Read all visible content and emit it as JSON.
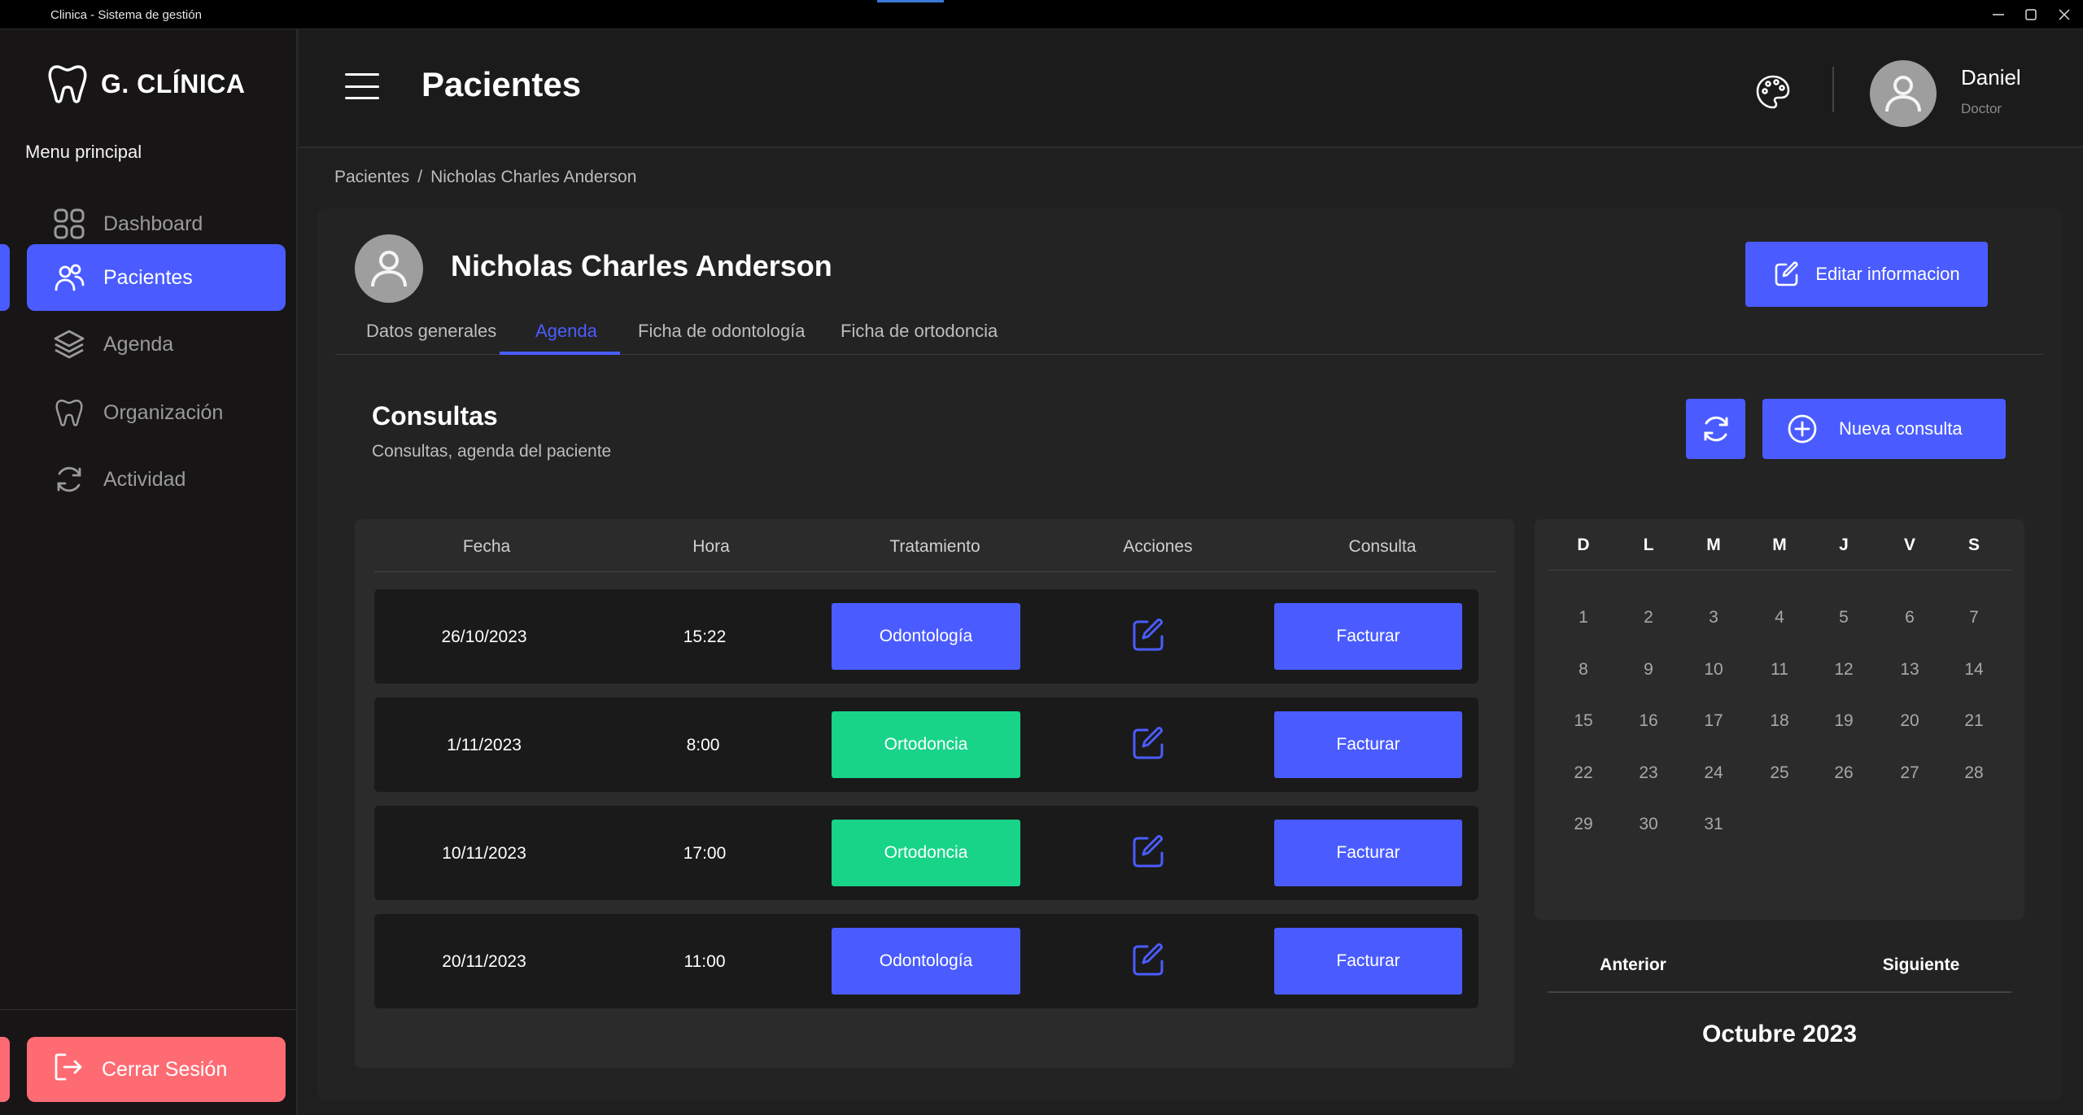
{
  "window": {
    "title": "Clinica - Sistema de gestión"
  },
  "sidebar": {
    "brand": "G. CLÍNICA",
    "menu_title": "Menu principal",
    "items": [
      {
        "label": "Dashboard",
        "icon": "grid-icon",
        "active": false
      },
      {
        "label": "Pacientes",
        "icon": "users-icon",
        "active": true
      },
      {
        "label": "Agenda",
        "icon": "layers-icon",
        "active": false
      },
      {
        "label": "Organización",
        "icon": "tooth-icon",
        "active": false
      },
      {
        "label": "Actividad",
        "icon": "refresh-icon",
        "active": false
      }
    ],
    "logout": "Cerrar Sesión"
  },
  "header": {
    "title": "Pacientes",
    "user": {
      "name": "Daniel",
      "role": "Doctor"
    }
  },
  "breadcrumb": {
    "root": "Pacientes",
    "separator": "/",
    "current": "Nicholas Charles Anderson"
  },
  "patient": {
    "name": "Nicholas Charles Anderson",
    "edit_label": "Editar informacion"
  },
  "tabs": [
    {
      "label": "Datos generales",
      "active": false
    },
    {
      "label": "Agenda",
      "active": true
    },
    {
      "label": "Ficha de odontología",
      "active": false
    },
    {
      "label": "Ficha de ortodoncia",
      "active": false
    }
  ],
  "consultas": {
    "title": "Consultas",
    "subtitle": "Consultas, agenda del paciente",
    "new_label": "Nueva consulta",
    "columns": [
      "Fecha",
      "Hora",
      "Tratamiento",
      "Acciones",
      "Consulta"
    ],
    "rows": [
      {
        "fecha": "26/10/2023",
        "hora": "15:22",
        "tratamiento": "Odontología",
        "type": "odonto",
        "consulta": "Facturar"
      },
      {
        "fecha": "1/11/2023",
        "hora": "8:00",
        "tratamiento": "Ortodoncia",
        "type": "orto",
        "consulta": "Facturar"
      },
      {
        "fecha": "10/11/2023",
        "hora": "17:00",
        "tratamiento": "Ortodoncia",
        "type": "orto",
        "consulta": "Facturar"
      },
      {
        "fecha": "20/11/2023",
        "hora": "11:00",
        "tratamiento": "Odontología",
        "type": "odonto",
        "consulta": "Facturar"
      }
    ]
  },
  "calendar": {
    "weekdays": [
      "D",
      "L",
      "M",
      "M",
      "J",
      "V",
      "S"
    ],
    "days": [
      [
        "1",
        "2",
        "3",
        "4",
        "5",
        "6",
        "7"
      ],
      [
        "8",
        "9",
        "10",
        "11",
        "12",
        "13",
        "14"
      ],
      [
        "15",
        "16",
        "17",
        "18",
        "19",
        "20",
        "21"
      ],
      [
        "22",
        "23",
        "24",
        "25",
        "26",
        "27",
        "28"
      ],
      [
        "29",
        "30",
        "31"
      ]
    ],
    "prev_label": "Anterior",
    "next_label": "Siguiente",
    "month_label": "Octubre 2023"
  },
  "colors": {
    "accent": "#4a5cff",
    "orto": "#17d488",
    "logout": "#ff6b73",
    "sidebar_bg": "#181516",
    "main_bg": "#1f1f1f"
  }
}
